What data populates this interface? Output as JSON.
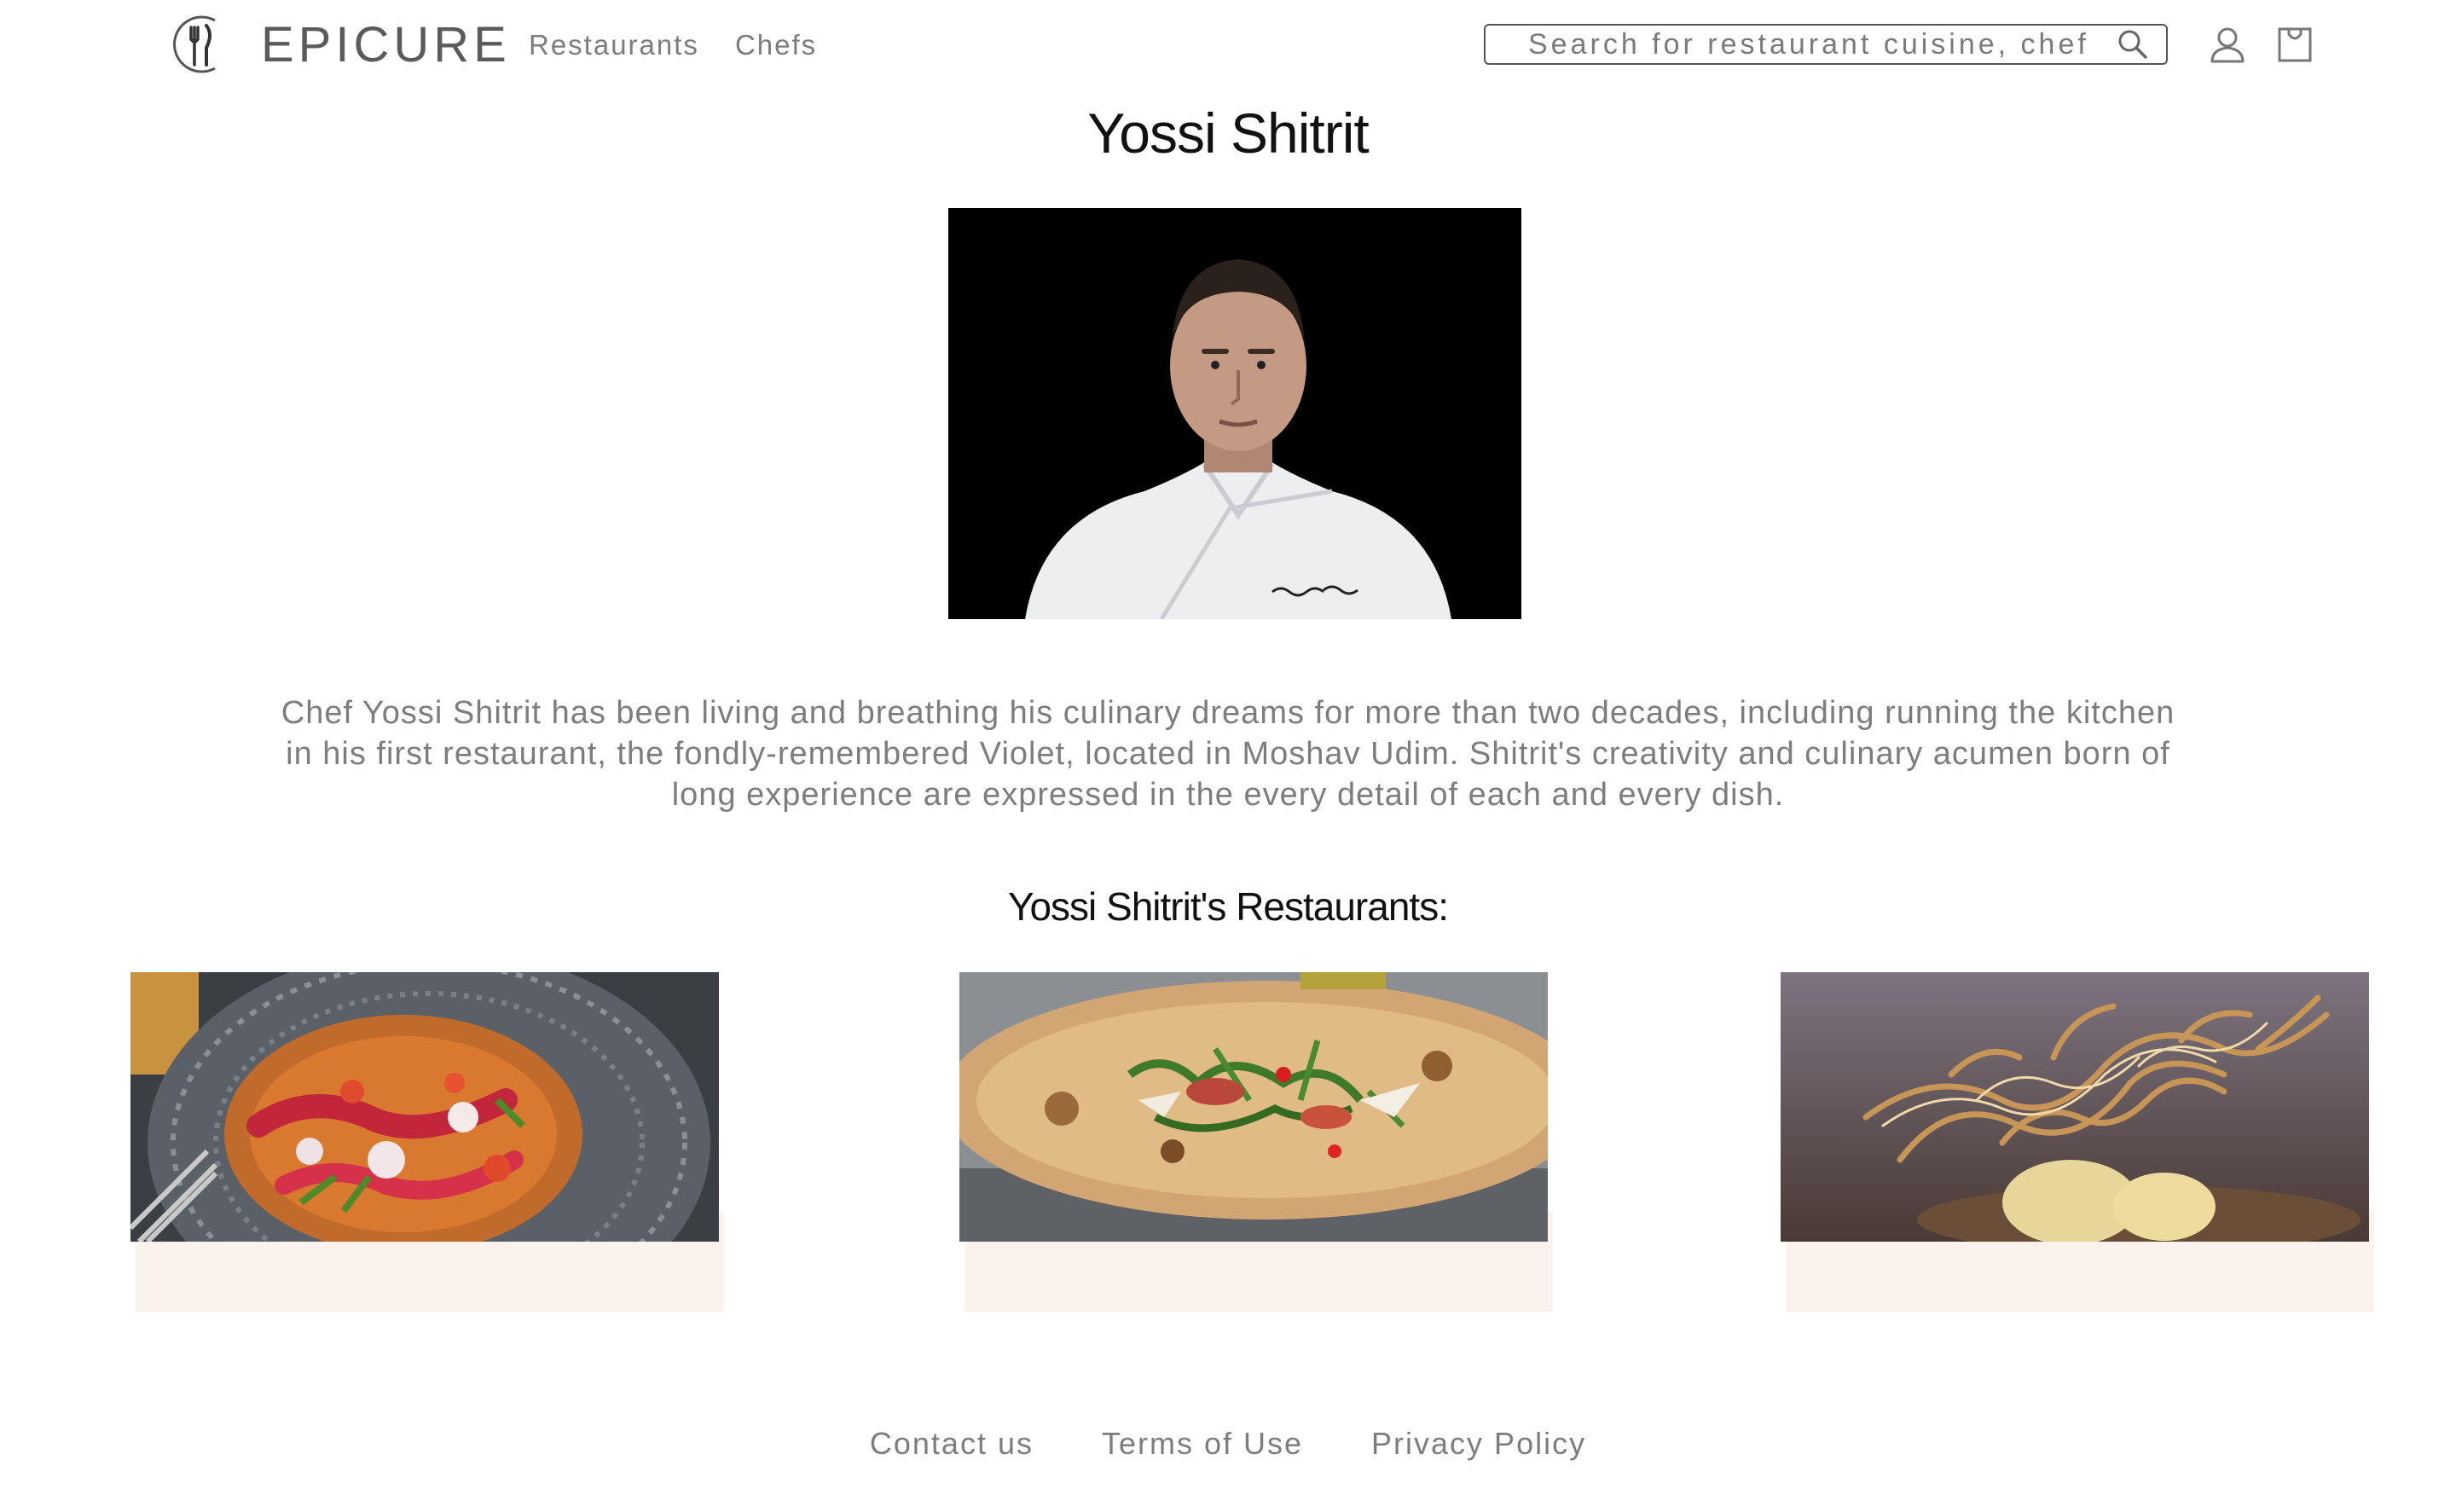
{
  "header": {
    "logo_text": "EPICURE",
    "nav": [
      {
        "label": "Restaurants"
      },
      {
        "label": "Chefs"
      }
    ],
    "search": {
      "placeholder": "Search for restaurant cuisine, chef",
      "value": ""
    }
  },
  "chef": {
    "name": "Yossi Shitrit",
    "photo_icon": "chef-portrait",
    "bio": "Chef Yossi Shitrit has been living and breathing his culinary dreams for more than two decades, including running the kitchen in his first restaurant, the fondly-remembered Violet, located in Moshav Udim. Shitrit's creativity and culinary acumen born of long experience are expressed in the every detail of each and every dish."
  },
  "restaurants": {
    "heading": "Yossi Shitrit's Restaurants:",
    "items": [
      {
        "image": "carpaccio-dish"
      },
      {
        "image": "pizza-dish"
      },
      {
        "image": "golden-sugar-dessert"
      }
    ]
  },
  "footer": {
    "links": [
      {
        "label": "Contact us"
      },
      {
        "label": "Terms of Use"
      },
      {
        "label": "Privacy Policy"
      }
    ]
  },
  "colors": {
    "text_muted": "#7d7d7d",
    "card_strip": "#f9f3eb",
    "photo_bg": "#000000"
  }
}
